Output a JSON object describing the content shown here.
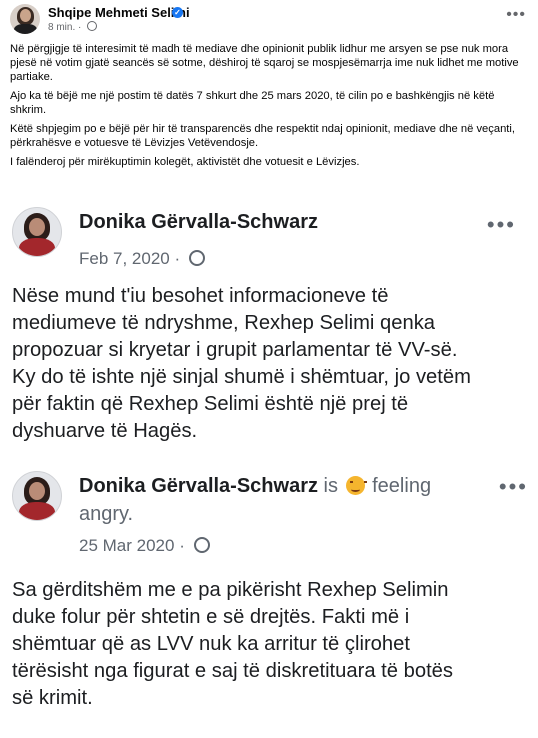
{
  "post": {
    "author": "Shqipe Mehmeti Selimi",
    "verified_mark": "✓",
    "time": "8 min.",
    "separator": "·",
    "more_label": "•••",
    "paragraphs": [
      "Në përgjigje të interesimit të madh të mediave dhe opinionit publik lidhur me arsyen se pse nuk mora pjesë në votim gjatë seancës së sotme, dëshiroj të sqaroj se mospjesëmarrja ime nuk lidhet me motive partiake.",
      "Ajo ka të bëjë me një postim të datës 7 shkurt dhe 25 mars 2020, të cilin po e bashkëngjis në këtë shkrim.",
      "Këtë shpjegim po e bëjë për hir të transparencës dhe respektit ndaj opinionit, mediave dhe në veçanti, përkrahësve e votuesve të Lëvizjes Vetëvendosje.",
      "I falënderoj për mirëkuptimin kolegët, aktivistët dhe votuesit e Lëvizjes."
    ]
  },
  "embedded": [
    {
      "name": "Donika Gërvalla-Schwarz",
      "date": "Feb 7, 2020",
      "separator": "·",
      "more_label": "•••",
      "lines": [
        "Nëse mund t'iu besohet informacioneve të",
        "mediumeve të ndryshme, Rexhep Selimi qenka",
        "propozuar si kryetar i grupit parlamentar të VV-së.",
        "Ky do të ishte një sinjal shumë i shëmtuar, jo vetëm",
        "për faktin që Rexhep Selimi është një prej të",
        "dyshuarve të Hagës."
      ]
    },
    {
      "name": "Donika Gërvalla-Schwarz",
      "status_prefix": "is",
      "status_feeling": "feeling",
      "status_line2": "angry.",
      "date": "25 Mar 2020",
      "separator": "·",
      "more_label": "•••",
      "lines": [
        "Sa gërditshëm me e pa pikërisht Rexhep Selimin",
        "duke folur për shtetin e së drejtës. Fakti më i",
        "shëmtuar që as LVV nuk ka arritur të çlirohet",
        "tërësisht nga figurat e saj të diskretituara të botës",
        "së krimit."
      ]
    }
  ],
  "colors": {
    "accent": "#1877f2",
    "text": "#050505",
    "secondary": "#65676b"
  }
}
